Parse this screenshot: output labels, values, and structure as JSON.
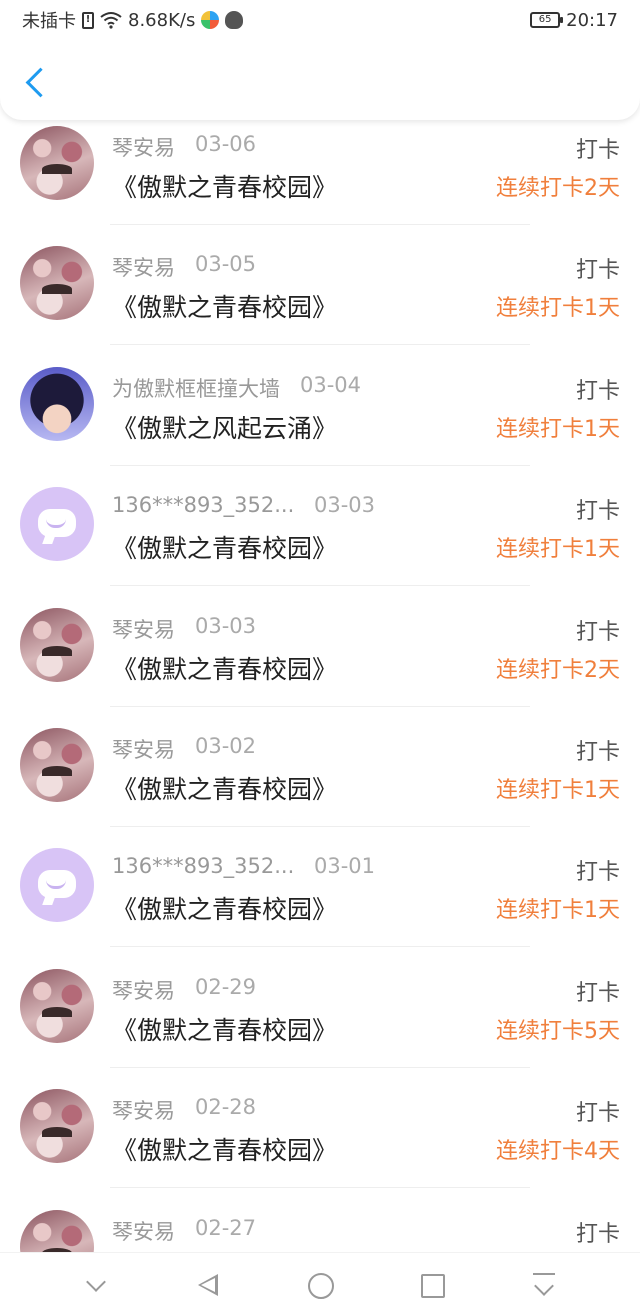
{
  "status_bar": {
    "carrier": "未插卡",
    "net_speed": "8.68K/s",
    "battery": "65",
    "time": "20:17"
  },
  "header": {
    "back_icon": "chevron-left-icon"
  },
  "action_label": "打卡",
  "items": [
    {
      "avatar": "photo",
      "name": "琴安易",
      "date": "03-06",
      "title": "《傲默之青春校园》",
      "streak": "连续打卡2天"
    },
    {
      "avatar": "photo",
      "name": "琴安易",
      "date": "03-05",
      "title": "《傲默之青春校园》",
      "streak": "连续打卡1天"
    },
    {
      "avatar": "anime",
      "name": "为傲默框框撞大墙",
      "date": "03-04",
      "title": "《傲默之风起云涌》",
      "streak": "连续打卡1天"
    },
    {
      "avatar": "bubble",
      "name": "136***893_352...",
      "date": "03-03",
      "title": "《傲默之青春校园》",
      "streak": "连续打卡1天"
    },
    {
      "avatar": "photo",
      "name": "琴安易",
      "date": "03-03",
      "title": "《傲默之青春校园》",
      "streak": "连续打卡2天"
    },
    {
      "avatar": "photo",
      "name": "琴安易",
      "date": "03-02",
      "title": "《傲默之青春校园》",
      "streak": "连续打卡1天"
    },
    {
      "avatar": "bubble",
      "name": "136***893_352...",
      "date": "03-01",
      "title": "《傲默之青春校园》",
      "streak": "连续打卡1天"
    },
    {
      "avatar": "photo",
      "name": "琴安易",
      "date": "02-29",
      "title": "《傲默之青春校园》",
      "streak": "连续打卡5天"
    },
    {
      "avatar": "photo",
      "name": "琴安易",
      "date": "02-28",
      "title": "《傲默之青春校园》",
      "streak": "连续打卡4天"
    },
    {
      "avatar": "photo",
      "name": "琴安易",
      "date": "02-27",
      "title": "",
      "streak": ""
    }
  ],
  "colors": {
    "accent": "#1e9bf0",
    "streak": "#f07f3c"
  }
}
